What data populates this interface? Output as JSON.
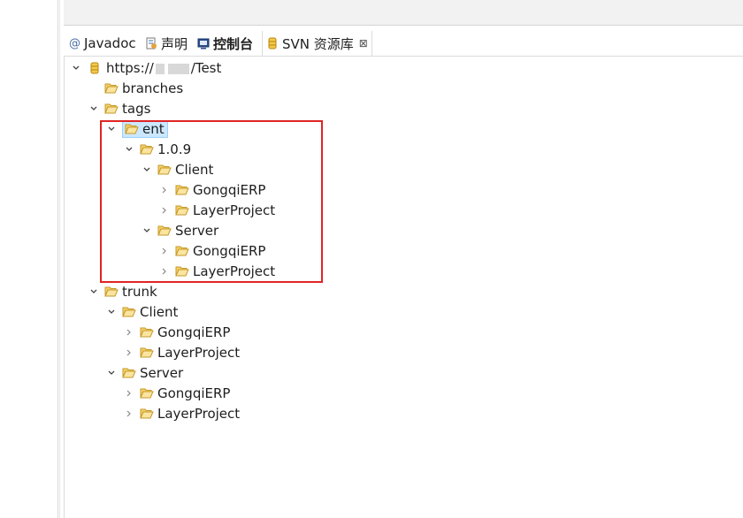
{
  "tabs": [
    {
      "label": "Javadoc",
      "icon": "javadoc-icon",
      "prefix": "@"
    },
    {
      "label": "声明",
      "icon": "declaration-icon"
    },
    {
      "label": "控制台",
      "icon": "console-icon"
    },
    {
      "label": "SVN 资源库",
      "icon": "svn-repository-icon",
      "close": "⊠"
    }
  ],
  "tree": {
    "root": {
      "label_prefix": "https://",
      "label_suffix": "/Test"
    },
    "branches": "branches",
    "tags": "tags",
    "ent": "ent",
    "version": "1.0.9",
    "ent_client": "Client",
    "ent_client_gongqi": "GongqiERP",
    "ent_client_layer": "LayerProject",
    "ent_server": "Server",
    "ent_server_gongqi": "GongqiERP",
    "ent_server_layer": "LayerProject",
    "trunk": "trunk",
    "trunk_client": "Client",
    "trunk_client_gongqi": "GongqiERP",
    "trunk_client_layer": "LayerProject",
    "trunk_server": "Server",
    "trunk_server_gongqi": "GongqiERP",
    "trunk_server_layer": "LayerProject"
  },
  "colors": {
    "highlight_border": "#e02424",
    "selection_bg": "#cce8ff",
    "folder_fill": "#f5d06a",
    "folder_stroke": "#c59a2a"
  }
}
